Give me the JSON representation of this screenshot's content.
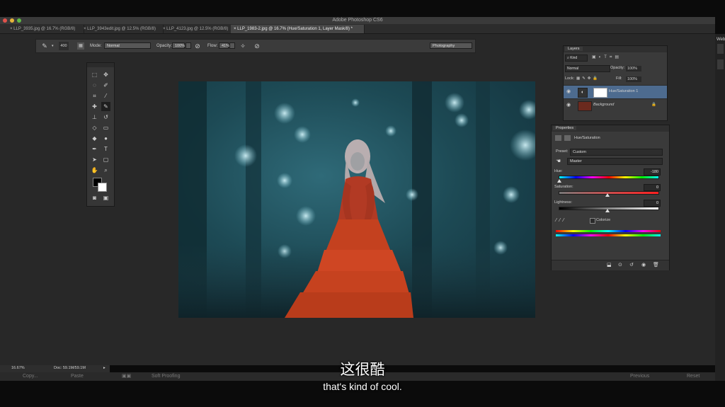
{
  "app": {
    "title": "Adobe Photoshop CS6"
  },
  "tabs": [
    {
      "label": "LLP_3935.jpg @ 16.7% (RGB/8)"
    },
    {
      "label": "LLP_3943edit.jpg @ 12.5% (RGB/8)"
    },
    {
      "label": "LLP_4123.jpg @ 12.5% (RGB/8)"
    },
    {
      "label": "LLP_1983-2.jpg @ 16.7% (Hue/Saturation 1, Layer Mask/8) *"
    }
  ],
  "options_bar": {
    "brush_size": "400",
    "mode_label": "Mode:",
    "mode_value": "Normal",
    "opacity_label": "Opacity:",
    "opacity_value": "100%",
    "flow_label": "Flow:",
    "flow_value": "41%",
    "workspace": "Photography"
  },
  "layers_panel": {
    "title": "Layers",
    "filter": "Kind",
    "blend_mode": "Normal",
    "opacity_label": "Opacity:",
    "opacity_value": "100%",
    "lock_label": "Lock:",
    "fill_label": "Fill:",
    "fill_value": "100%",
    "layers": [
      {
        "name": "Hue/Saturation 1",
        "selected": true
      },
      {
        "name": "Background",
        "selected": false
      }
    ]
  },
  "properties_panel": {
    "title": "Properties",
    "adjustment": "Hue/Saturation",
    "preset_label": "Preset:",
    "preset_value": "Custom",
    "channel_value": "Master",
    "hue_label": "Hue:",
    "hue_value": "-180",
    "saturation_label": "Saturation:",
    "saturation_value": "0",
    "lightness_label": "Lightness:",
    "lightness_value": "0",
    "colorize_label": "Colorize"
  },
  "status": {
    "zoom": "16.67%",
    "doc": "Doc: 59.1M/59.1M"
  },
  "bottom_bar": {
    "copy": "Copy...",
    "paste": "Paste",
    "soft_proofing": "Soft Proofing",
    "previous": "Previous",
    "reset": "Reset"
  },
  "subtitles": {
    "chinese": "这很酷",
    "english": "that's kind of cool."
  },
  "right_edge": {
    "label": "Web"
  },
  "colors": {
    "background": "#282828",
    "panel": "#3a3a3a",
    "selected_layer": "#4d6b8f"
  }
}
